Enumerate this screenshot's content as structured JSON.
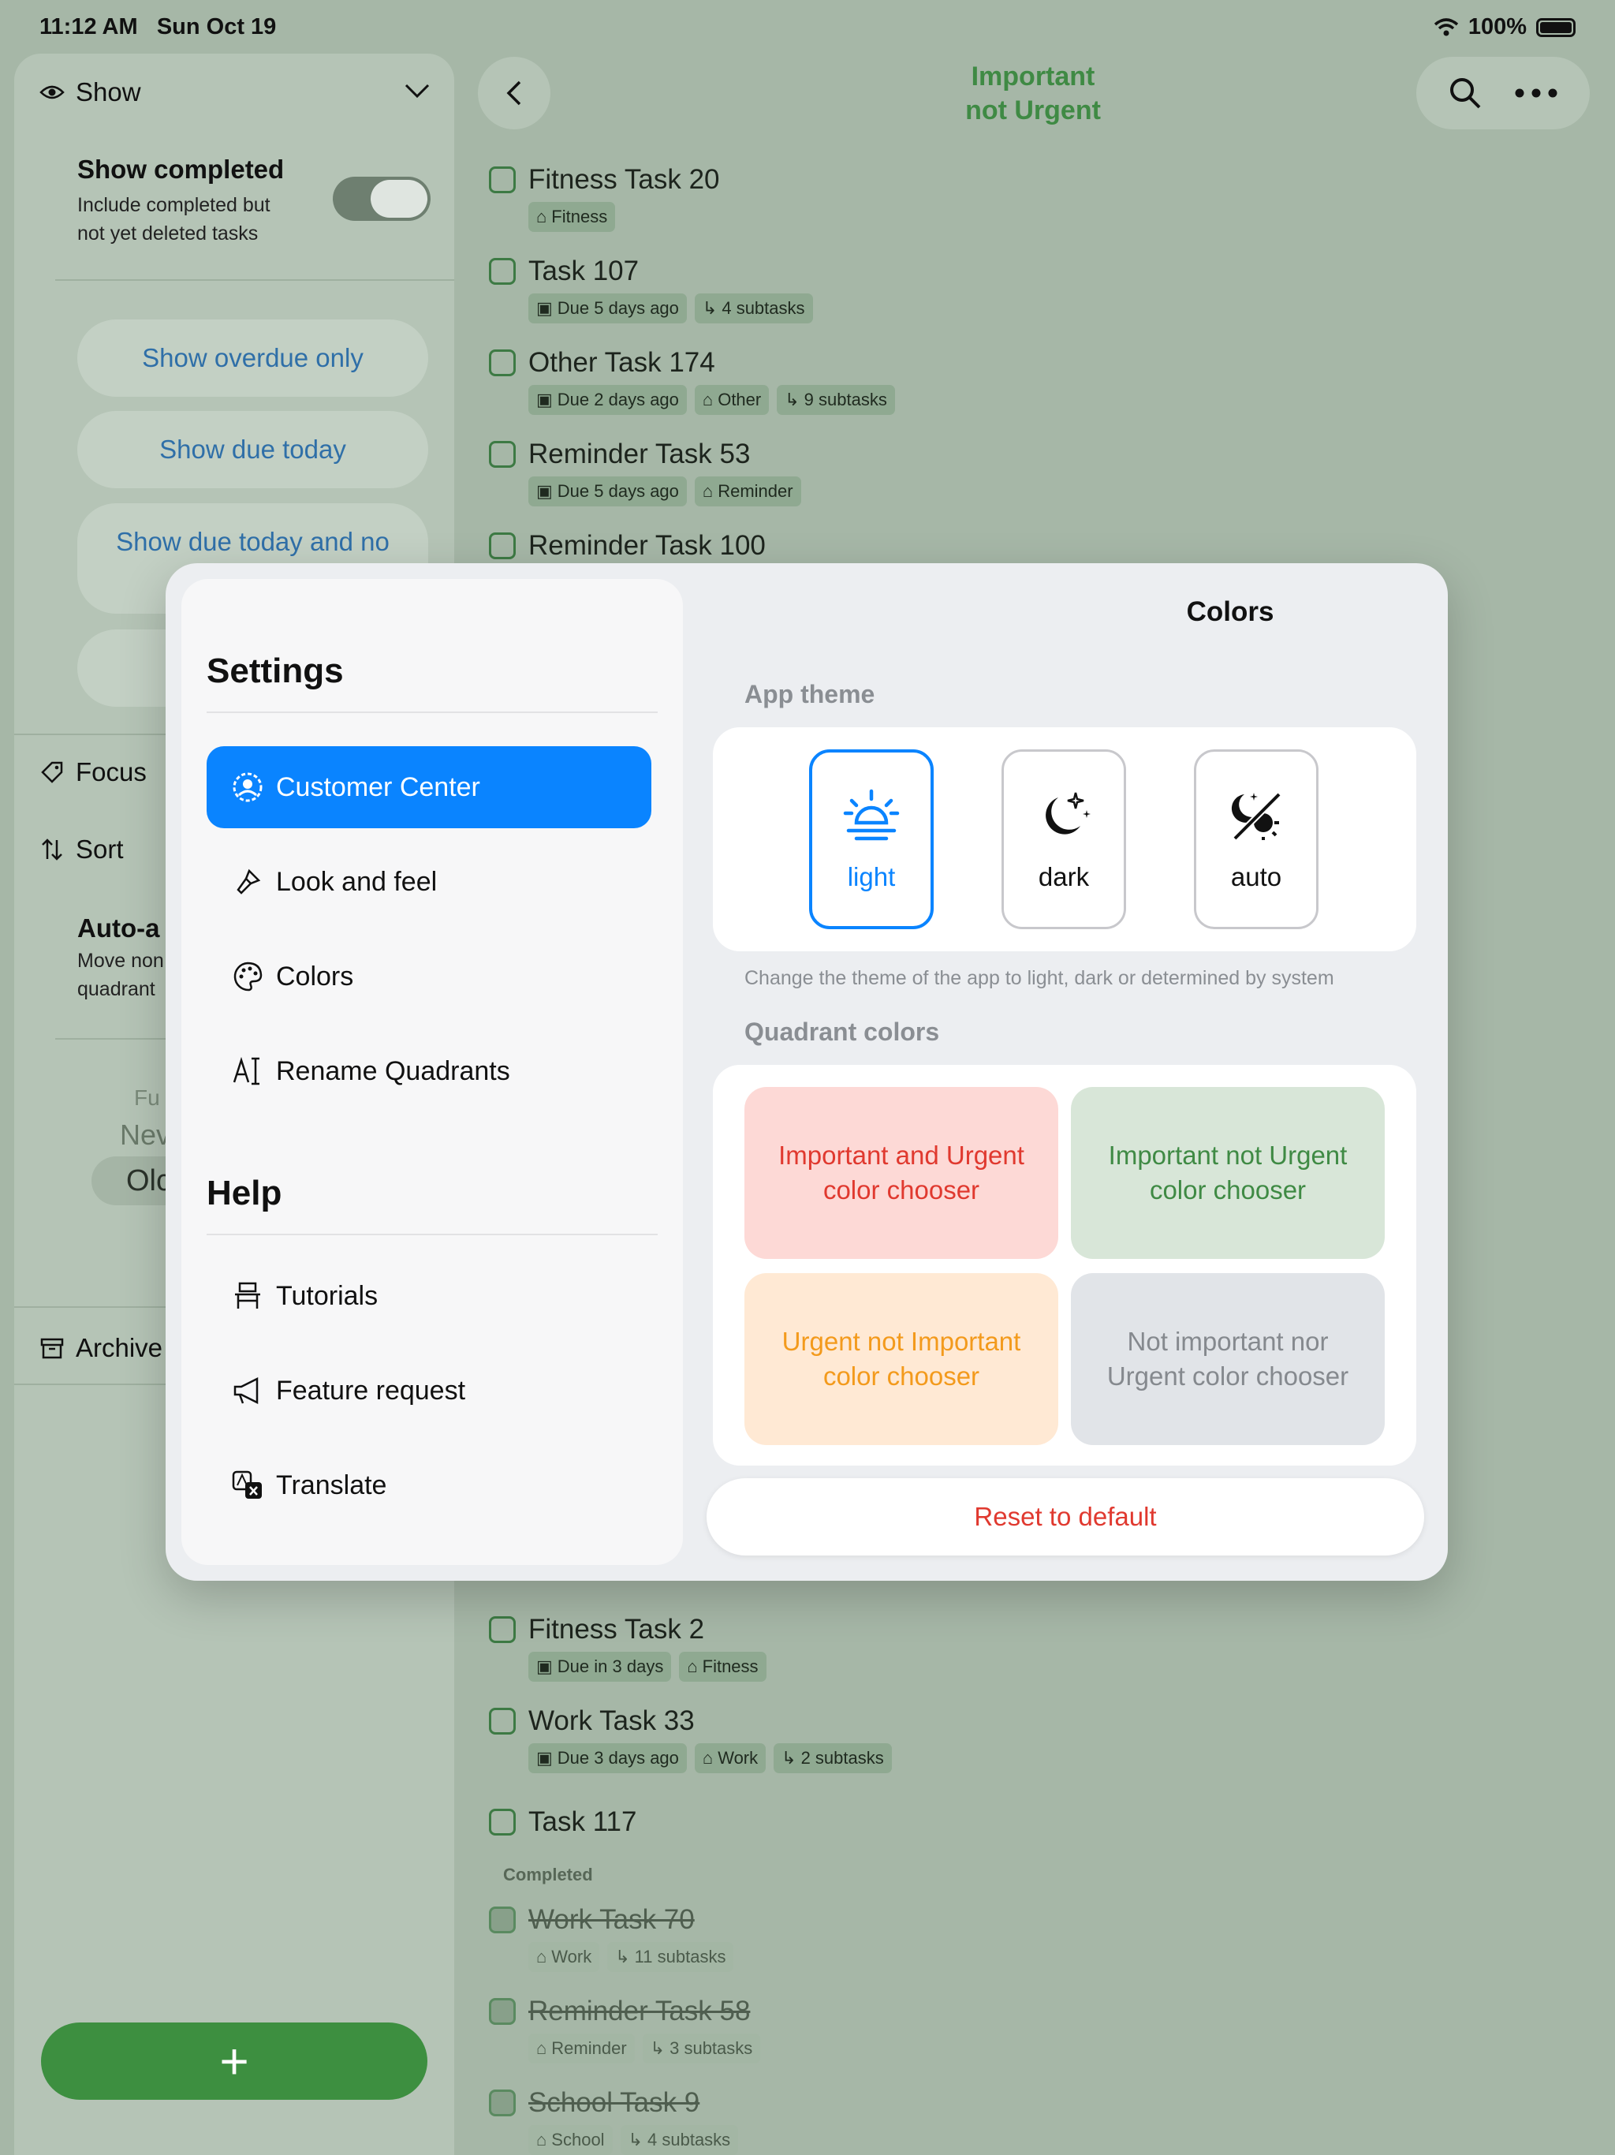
{
  "status": {
    "time": "11:12 AM",
    "date": "Sun Oct 19",
    "battery": "100%"
  },
  "sidebar": {
    "show_label": "Show",
    "show_completed_title": "Show completed",
    "show_completed_desc_1": "Include completed but",
    "show_completed_desc_2": "not yet deleted tasks",
    "show_completed_on": true,
    "filters": [
      "Show overdue only",
      "Show due today",
      "Show due today and no"
    ],
    "focus_label": "Focus",
    "sort_label": "Sort",
    "auto_title": "Auto-a",
    "auto_desc_1": "Move non",
    "auto_desc_2": "quadrant",
    "sort_opt_1": "Fu",
    "sort_opt_2": "Nev",
    "sort_opt_3": "Olc",
    "archive_label": "Archive",
    "add_label": "+"
  },
  "header": {
    "title_line1": "Important",
    "title_line2": "not Urgent",
    "title_color": "#3f8a44"
  },
  "tasks_top": [
    {
      "title": "Fitness Task 20",
      "chips": [
        {
          "icon": "tag-icon",
          "text": "Fitness"
        }
      ]
    },
    {
      "title": "Task 107",
      "chips": [
        {
          "icon": "calendar-icon",
          "text": "Due 5 days ago"
        },
        {
          "icon": "subtask-icon",
          "text": "4 subtasks"
        }
      ]
    },
    {
      "title": "Other Task 174",
      "chips": [
        {
          "icon": "calendar-icon",
          "text": "Due 2 days ago"
        },
        {
          "icon": "tag-icon",
          "text": "Other"
        },
        {
          "icon": "subtask-icon",
          "text": "9 subtasks"
        }
      ]
    },
    {
      "title": "Reminder Task 53",
      "chips": [
        {
          "icon": "calendar-icon",
          "text": "Due 5 days ago"
        },
        {
          "icon": "tag-icon",
          "text": "Reminder"
        }
      ]
    },
    {
      "title": "Reminder Task 100",
      "chips": []
    }
  ],
  "tasks_bottom": [
    {
      "title": "Fitness Task 2",
      "chips": [
        {
          "icon": "calendar-icon",
          "text": "Due in 3 days"
        },
        {
          "icon": "tag-icon",
          "text": "Fitness"
        }
      ]
    },
    {
      "title": "Work Task 33",
      "chips": [
        {
          "icon": "calendar-icon",
          "text": "Due 3 days ago"
        },
        {
          "icon": "tag-icon",
          "text": "Work"
        },
        {
          "icon": "subtask-icon",
          "text": "2 subtasks"
        }
      ]
    },
    {
      "title": "Task 117",
      "chips": []
    }
  ],
  "completed_label": "Completed",
  "tasks_completed": [
    {
      "title": "Work Task 70",
      "chips": [
        {
          "icon": "tag-icon",
          "text": "Work"
        },
        {
          "icon": "subtask-icon",
          "text": "11 subtasks"
        }
      ]
    },
    {
      "title": "Reminder Task 58",
      "chips": [
        {
          "icon": "tag-icon",
          "text": "Reminder"
        },
        {
          "icon": "subtask-icon",
          "text": "3 subtasks"
        }
      ]
    },
    {
      "title": "School Task 9",
      "chips": [
        {
          "icon": "tag-icon",
          "text": "School"
        },
        {
          "icon": "subtask-icon",
          "text": "4 subtasks"
        }
      ]
    }
  ],
  "settings": {
    "heading": "Settings",
    "items": [
      {
        "label": "Customer Center",
        "icon": "person-circle-icon",
        "selected": true
      },
      {
        "label": "Look and feel",
        "icon": "paintbrush-icon",
        "selected": false
      },
      {
        "label": "Colors",
        "icon": "palette-icon",
        "selected": false
      },
      {
        "label": "Rename Quadrants",
        "icon": "text-cursor-icon",
        "selected": false
      }
    ],
    "help_heading": "Help",
    "help_items": [
      {
        "label": "Tutorials",
        "icon": "desk-icon"
      },
      {
        "label": "Feature request",
        "icon": "megaphone-icon"
      },
      {
        "label": "Translate",
        "icon": "translate-icon"
      }
    ]
  },
  "colors_panel": {
    "title": "Colors",
    "app_theme_label": "App theme",
    "themes": [
      {
        "label": "light",
        "icon": "sunrise-icon",
        "selected": true
      },
      {
        "label": "dark",
        "icon": "moon-stars-icon",
        "selected": false
      },
      {
        "label": "auto",
        "icon": "auto-theme-icon",
        "selected": false
      }
    ],
    "theme_hint": "Change the theme of the app to light, dark or determined by system",
    "quadrant_label": "Quadrant colors",
    "quadrants": [
      {
        "label": "Important and Urgent color chooser",
        "bg": "#fdd9d6",
        "fg": "#e0392f"
      },
      {
        "label": "Important not Urgent color chooser",
        "bg": "#d8e6d8",
        "fg": "#3f8a44"
      },
      {
        "label": "Urgent not Important color chooser",
        "bg": "#ffe9d4",
        "fg": "#f39a1c"
      },
      {
        "label": "Not important nor Urgent color chooser",
        "bg": "#e1e4e8",
        "fg": "#85898e"
      }
    ],
    "reset_label": "Reset to default"
  }
}
